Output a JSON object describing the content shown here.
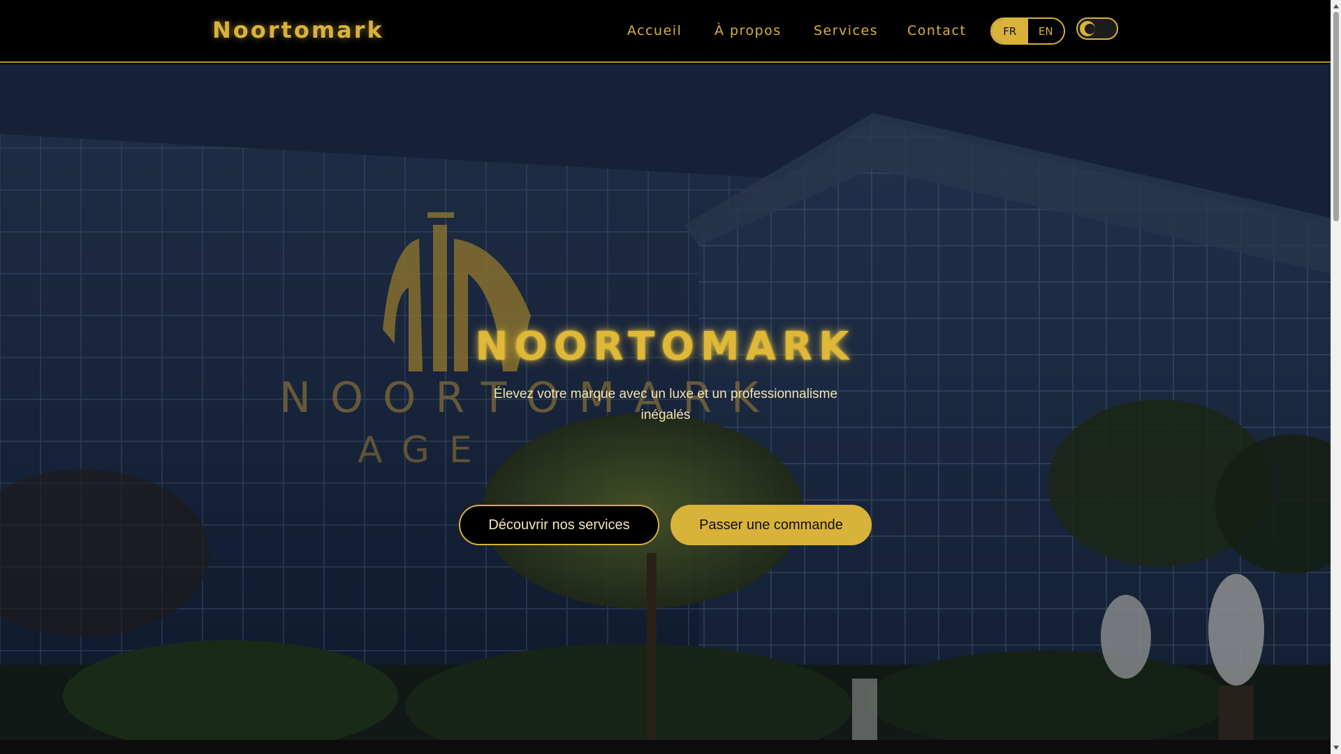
{
  "header": {
    "logo": "Noortomark",
    "nav": [
      "Accueil",
      "À propos",
      "Services",
      "Contact"
    ],
    "lang": {
      "active": "FR",
      "inactive": "EN"
    },
    "theme_icon": "moon-icon"
  },
  "hero": {
    "title": "NOORTOMARK",
    "subtitle": "Élevez votre marque avec un luxe et un professionnalisme inégalés",
    "btn_services": "Découvrir nos services",
    "btn_order": "Passer une commande",
    "sign_brand": "NOORTOMARK",
    "sign_line2": "AGE",
    "sign_monogram": "NM"
  },
  "colors": {
    "gold": "#d9b23a",
    "header_bg": "#000000",
    "hero_tint": "#1b2a44"
  }
}
